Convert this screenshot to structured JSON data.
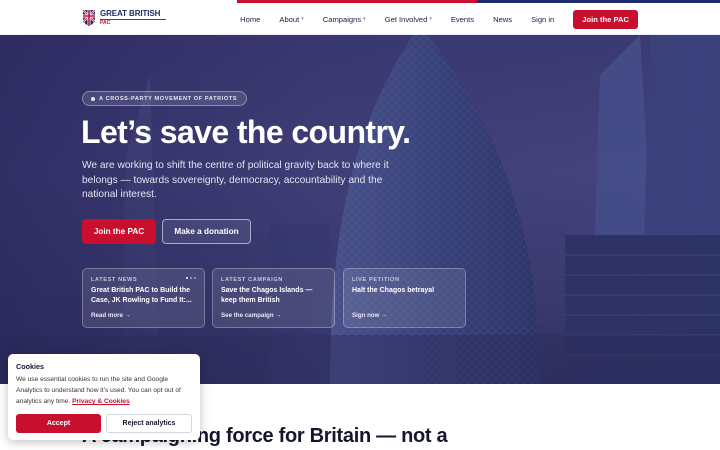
{
  "brand": {
    "title": "GREAT BRITISH",
    "subtitle": "PAC",
    "colors": {
      "red": "#c8102e",
      "navy": "#1f2a6b"
    }
  },
  "nav": {
    "items": [
      {
        "label": "Home",
        "has_dropdown": false
      },
      {
        "label": "About",
        "has_dropdown": true
      },
      {
        "label": "Campaigns",
        "has_dropdown": true
      },
      {
        "label": "Get Involved",
        "has_dropdown": true
      },
      {
        "label": "Events",
        "has_dropdown": false
      },
      {
        "label": "News",
        "has_dropdown": false
      },
      {
        "label": "Sign in",
        "has_dropdown": false
      }
    ],
    "cta": "Join the PAC",
    "caret": "▾"
  },
  "hero": {
    "pill": "A CROSS-PARTY MOVEMENT OF PATRIOTS",
    "title": "Let’s save the country.",
    "subtitle": "We are working to shift the centre of political gravity back to where it belongs — towards sovereignty, democracy, accountability and the national interest.",
    "primary_cta": "Join the PAC",
    "secondary_cta": "Make a donation"
  },
  "cards": [
    {
      "label": "LATEST NEWS",
      "title": "Great British PAC to Build the Case, JK Rowling to Fund It:...",
      "link": "Read more →"
    },
    {
      "label": "LATEST CAMPAIGN",
      "title": "Save the Chagos Islands — keep them British",
      "link": "See the campaign →"
    },
    {
      "label": "LIVE PETITION",
      "title": "Halt the Chagos betrayal",
      "link": "Sign now →"
    }
  ],
  "section": {
    "title": "A campaigning force for Britain — not a"
  },
  "cookie": {
    "title": "Cookies",
    "text": "We use essential cookies to run the site and Google Analytics to understand how it’s used. You can opt out of analytics any time.",
    "link": "Privacy & Cookies",
    "accept": "Accept",
    "reject": "Reject analytics"
  }
}
